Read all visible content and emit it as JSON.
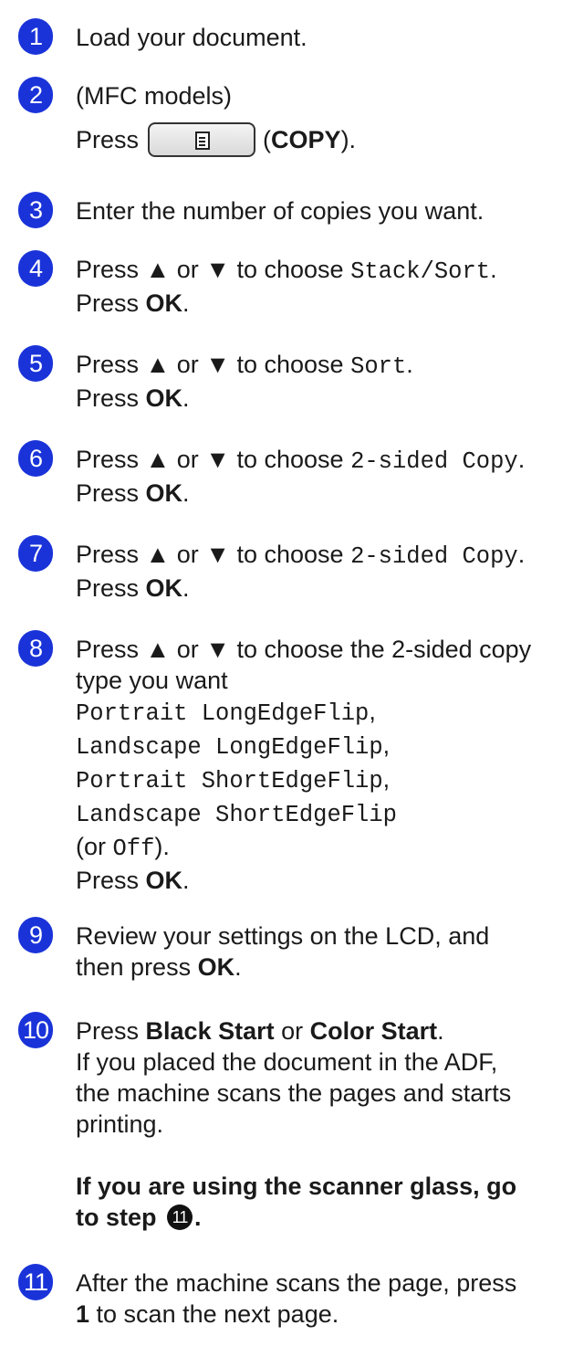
{
  "accent_color": "#1a33d9",
  "steps": [
    {
      "num": "1",
      "lines": [
        "Load your document."
      ]
    },
    {
      "num": "2",
      "line1": "(MFC models)",
      "press": "Press",
      "button_icon": "copy-document-icon",
      "paren_open": "(",
      "copy_label": "COPY",
      "paren_close": ")."
    },
    {
      "num": "3",
      "lines": [
        "Enter the number of copies you want."
      ]
    },
    {
      "num": "4",
      "prefix": "Press ▲ or ▼ to choose ",
      "option": "Stack/Sort",
      "suffix": ".",
      "press": "Press ",
      "ok": "OK",
      "dot": "."
    },
    {
      "num": "5",
      "prefix": "Press ▲ or ▼ to choose ",
      "option": "Sort",
      "suffix": ".",
      "press": "Press ",
      "ok": "OK",
      "dot": "."
    },
    {
      "num": "6",
      "prefix": "Press ▲ or ▼ to choose ",
      "option": "2-sided Copy",
      "suffix": ".",
      "press": "Press ",
      "ok": "OK",
      "dot": "."
    },
    {
      "num": "7",
      "prefix": "Press ▲ or ▼ to choose ",
      "option": "2-sided Copy",
      "suffix": ".",
      "press": "Press ",
      "ok": "OK",
      "dot": "."
    },
    {
      "num": "8",
      "line1": "Press ▲ or ▼ to choose the 2-sided copy",
      "line2": "type you want",
      "options": [
        "Portrait LongEdgeFlip",
        "Landscape LongEdgeFlip",
        "Portrait ShortEdgeFlip",
        "Landscape ShortEdgeFlip"
      ],
      "option_seps": [
        ",",
        ",",
        ",",
        ""
      ],
      "or_open": "(or ",
      "off": "Off",
      "or_close": ").",
      "press": "Press ",
      "ok": "OK",
      "dot": "."
    },
    {
      "num": "9",
      "line1": "Review your settings on the LCD, and",
      "line2_prefix": "then press ",
      "ok": "OK",
      "dot": "."
    },
    {
      "num": "10",
      "press": "Press ",
      "black": "Black Start",
      "or": " or ",
      "color": "Color Start",
      "dot": ".",
      "lines": [
        "If you placed the document in the ADF,",
        "the machine scans the pages and starts",
        "printing."
      ],
      "bold_line1": "If you are using the scanner glass, go",
      "bold_line2_prefix": "to step ",
      "step_ref": "11",
      "bold_line2_suffix": "."
    },
    {
      "num": "11",
      "line1": "After the machine scans the page, press",
      "key": "1",
      "line2_suffix": " to scan the next page."
    }
  ]
}
